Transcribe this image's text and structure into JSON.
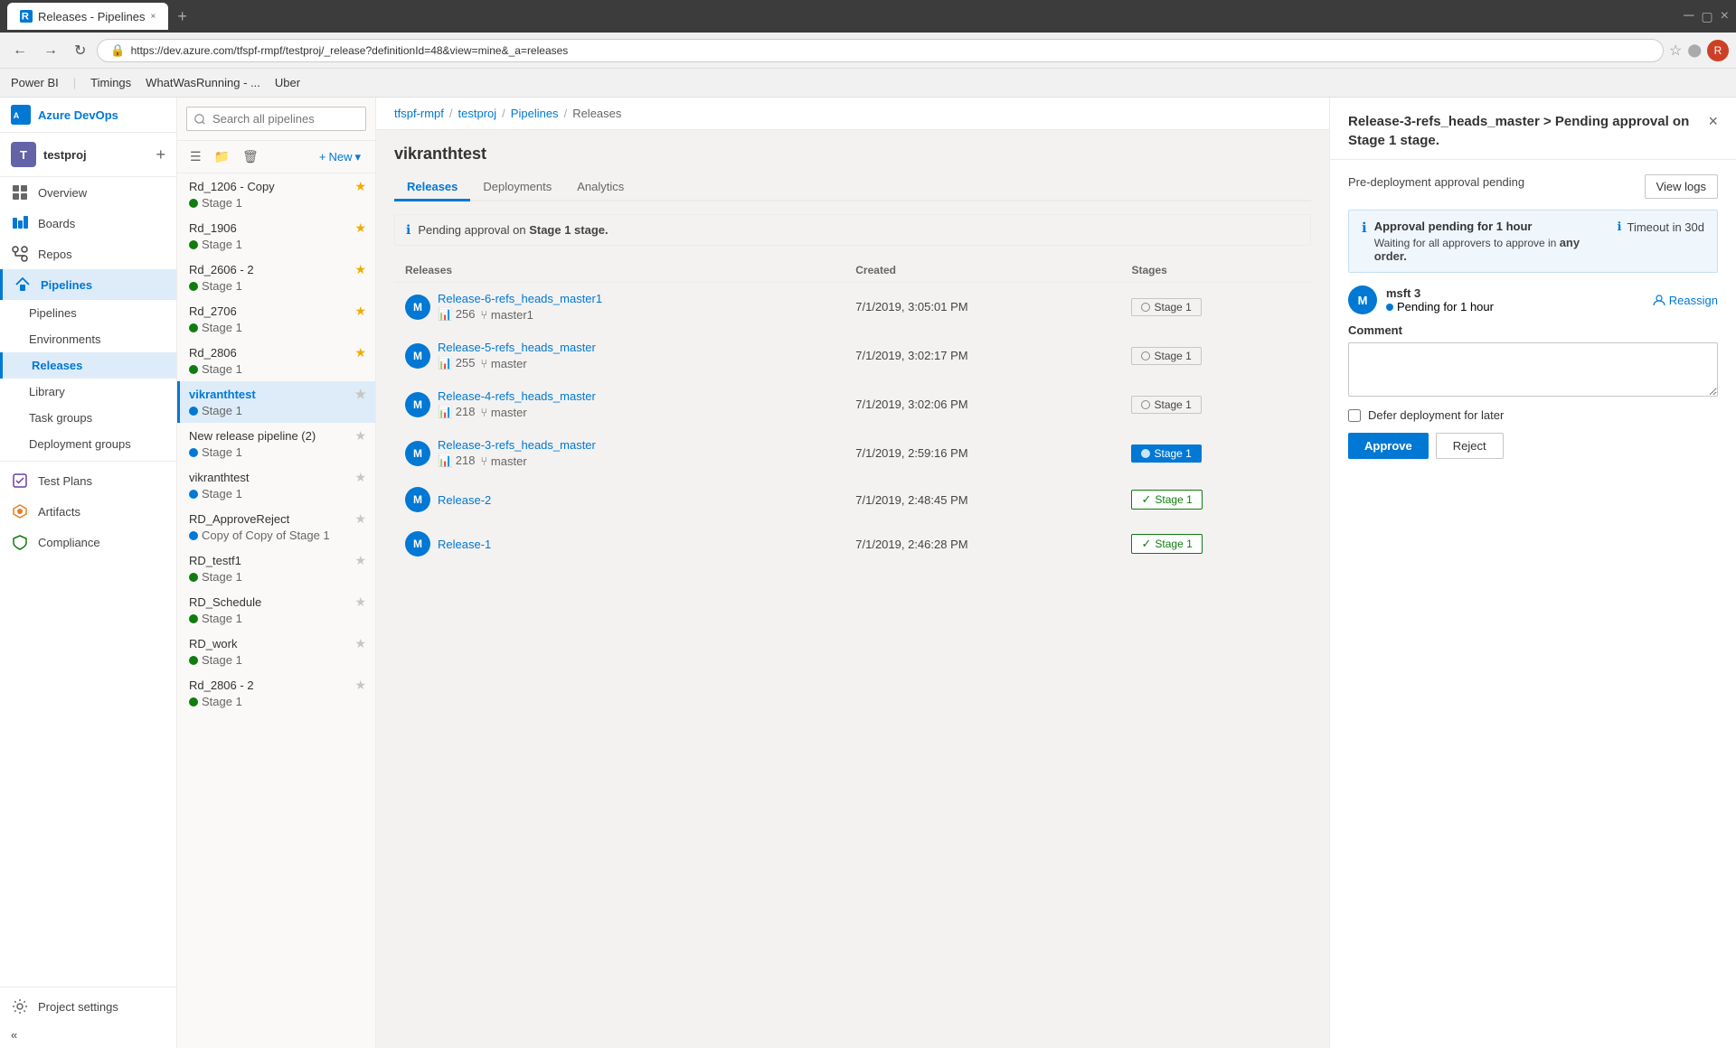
{
  "browser": {
    "tab_title": "Releases - Pipelines",
    "tab_close": "×",
    "tab_plus": "+",
    "url": "https://dev.azure.com/tfspf-rmpf/testproj/_release?definitionId=48&view=mine&_a=releases",
    "bookmarks": [
      {
        "label": "Power BI"
      },
      {
        "label": "Timings"
      },
      {
        "label": "WhatWasRunning - ..."
      },
      {
        "label": "Uber"
      }
    ]
  },
  "sidebar": {
    "org_initial": "T",
    "org_name": "testproj",
    "devops_label": "Azure DevOps",
    "nav_items": [
      {
        "label": "Overview",
        "icon": "overview"
      },
      {
        "label": "Boards",
        "icon": "boards"
      },
      {
        "label": "Repos",
        "icon": "repos"
      },
      {
        "label": "Pipelines",
        "icon": "pipelines",
        "active": true
      },
      {
        "label": "Test Plans",
        "icon": "test-plans"
      },
      {
        "label": "Artifacts",
        "icon": "artifacts"
      },
      {
        "label": "Compliance",
        "icon": "compliance"
      }
    ],
    "pipelines_sub": [
      {
        "label": "Pipelines",
        "icon": "pipelines-sub"
      },
      {
        "label": "Environments",
        "icon": "environments"
      },
      {
        "label": "Releases",
        "icon": "releases",
        "active": true
      },
      {
        "label": "Library",
        "icon": "library"
      },
      {
        "label": "Task groups",
        "icon": "task-groups"
      },
      {
        "label": "Deployment groups",
        "icon": "deployment-groups"
      }
    ],
    "settings_label": "Project settings"
  },
  "pipeline_list": {
    "search_placeholder": "Search all pipelines",
    "new_label": "New",
    "entries": [
      {
        "name": "Rd_1206 - Copy",
        "stage": "Stage 1",
        "starred": true,
        "stage_color": "green"
      },
      {
        "name": "Rd_1906",
        "stage": "Stage 1",
        "starred": true,
        "stage_color": "green"
      },
      {
        "name": "Rd_2606 - 2",
        "stage": "Stage 1",
        "starred": true,
        "stage_color": "green"
      },
      {
        "name": "Rd_2706",
        "stage": "Stage 1",
        "starred": true,
        "stage_color": "green"
      },
      {
        "name": "Rd_2806",
        "stage": "Stage 1",
        "starred": true,
        "stage_color": "green"
      },
      {
        "name": "vikranthtest",
        "stage": "Stage 1",
        "starred": false,
        "stage_color": "blue",
        "active": true,
        "bold": true
      },
      {
        "name": "New release pipeline (2)",
        "stage": "Stage 1",
        "starred": false,
        "stage_color": "blue"
      },
      {
        "name": "vikranthtest",
        "stage": "Stage 1",
        "starred": false,
        "stage_color": "blue"
      },
      {
        "name": "RD_ApproveReject",
        "stage": "Copy of Copy of Stage 1",
        "starred": false,
        "stage_color": "blue"
      },
      {
        "name": "RD_testf1",
        "stage": "Stage 1",
        "starred": false,
        "stage_color": "green"
      },
      {
        "name": "RD_Schedule",
        "stage": "Stage 1",
        "starred": false,
        "stage_color": "green"
      },
      {
        "name": "RD_work",
        "stage": "Stage 1",
        "starred": false,
        "stage_color": "green"
      },
      {
        "name": "Rd_2806 - 2",
        "stage": "Stage 1",
        "starred": false,
        "stage_color": "green"
      }
    ]
  },
  "breadcrumb": {
    "items": [
      "tfspf-rmpf",
      "testproj",
      "Pipelines",
      "Releases"
    ]
  },
  "main": {
    "title": "vikranthtest",
    "tabs": [
      {
        "label": "Releases",
        "active": true
      },
      {
        "label": "Deployments"
      },
      {
        "label": "Analytics"
      }
    ],
    "info_message": "Pending approval on ",
    "info_stage": "Stage 1 stage.",
    "table_headers": [
      "Releases",
      "Created",
      "Stages"
    ],
    "releases": [
      {
        "name": "Release-6-refs_heads_master1",
        "avatar": "M",
        "commits": "256",
        "branch": "master1",
        "created": "7/1/2019, 3:05:01 PM",
        "stage": "Stage 1",
        "stage_type": "pending"
      },
      {
        "name": "Release-5-refs_heads_master",
        "avatar": "M",
        "commits": "255",
        "branch": "master",
        "created": "7/1/2019, 3:02:17 PM",
        "stage": "Stage 1",
        "stage_type": "pending"
      },
      {
        "name": "Release-4-refs_heads_master",
        "avatar": "M",
        "commits": "218",
        "branch": "master",
        "created": "7/1/2019, 3:02:06 PM",
        "stage": "Stage 1",
        "stage_type": "pending"
      },
      {
        "name": "Release-3-refs_heads_master",
        "avatar": "M",
        "commits": "218",
        "branch": "master",
        "created": "7/1/2019, 2:59:16 PM",
        "stage": "Stage 1",
        "stage_type": "blue_active"
      },
      {
        "name": "Release-2",
        "avatar": "M",
        "commits": "",
        "branch": "",
        "created": "7/1/2019, 2:48:45 PM",
        "stage": "Stage 1",
        "stage_type": "green_done"
      },
      {
        "name": "Release-1",
        "avatar": "M",
        "commits": "",
        "branch": "",
        "created": "7/1/2019, 2:46:28 PM",
        "stage": "Stage 1",
        "stage_type": "green_done"
      }
    ]
  },
  "right_panel": {
    "title": "Release-3-refs_heads_master > Pending approval on Stage 1 stage.",
    "close_label": "×",
    "approval_label": "Pre-deployment approval pending",
    "view_logs_label": "View logs",
    "status_box": {
      "left_icon": "ℹ",
      "left_text": "Approval pending for 1 hour",
      "sub_text": "Waiting for all approvers to approve in any order.",
      "right_icon": "ℹ",
      "right_text": "Timeout in 30d"
    },
    "approver": {
      "initial": "M",
      "name": "msft 3",
      "status": "Pending for 1 hour"
    },
    "reassign_label": "Reassign",
    "comment_label": "Comment",
    "comment_placeholder": "",
    "defer_label": "Defer deployment for later",
    "approve_label": "Approve",
    "reject_label": "Reject"
  }
}
